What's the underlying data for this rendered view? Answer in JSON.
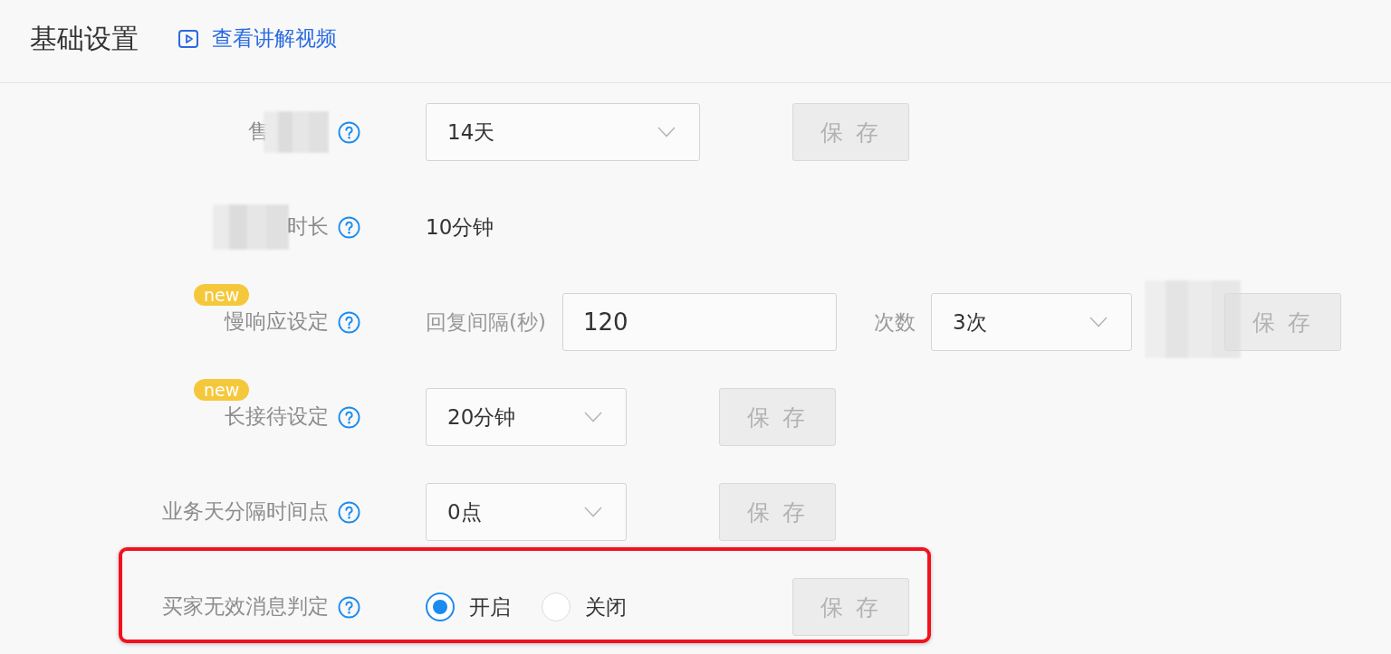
{
  "header": {
    "title": "基础设置",
    "video_link": "查看讲解视频"
  },
  "settings": [
    {
      "kind": "select",
      "label": "售",
      "redacted_after": true,
      "value": "14天",
      "save": {
        "label": "保 存",
        "disabled": true
      }
    },
    {
      "kind": "text",
      "label": "时长",
      "redacted_before": true,
      "value": "10分钟"
    },
    {
      "kind": "interval",
      "label": "慢响应设定",
      "badge": "new",
      "interval_label": "回复间隔(秒)",
      "interval_value": "120",
      "count_label": "次数",
      "count_value": "3次",
      "save": {
        "label": "保 存",
        "disabled": true,
        "redacted": true
      }
    },
    {
      "kind": "select",
      "label": "长接待设定",
      "badge": "new",
      "value": "20分钟",
      "save": {
        "label": "保 存",
        "disabled": true
      }
    },
    {
      "kind": "select",
      "label": "业务天分隔时间点",
      "value": "0点",
      "save": {
        "label": "保 存",
        "disabled": true
      }
    },
    {
      "kind": "radio",
      "label": "买家无效消息判定",
      "highlighted": true,
      "options": [
        {
          "label": "开启",
          "selected": true
        },
        {
          "label": "关闭",
          "selected": false
        }
      ],
      "save": {
        "label": "保 存",
        "disabled": true
      }
    }
  ]
}
